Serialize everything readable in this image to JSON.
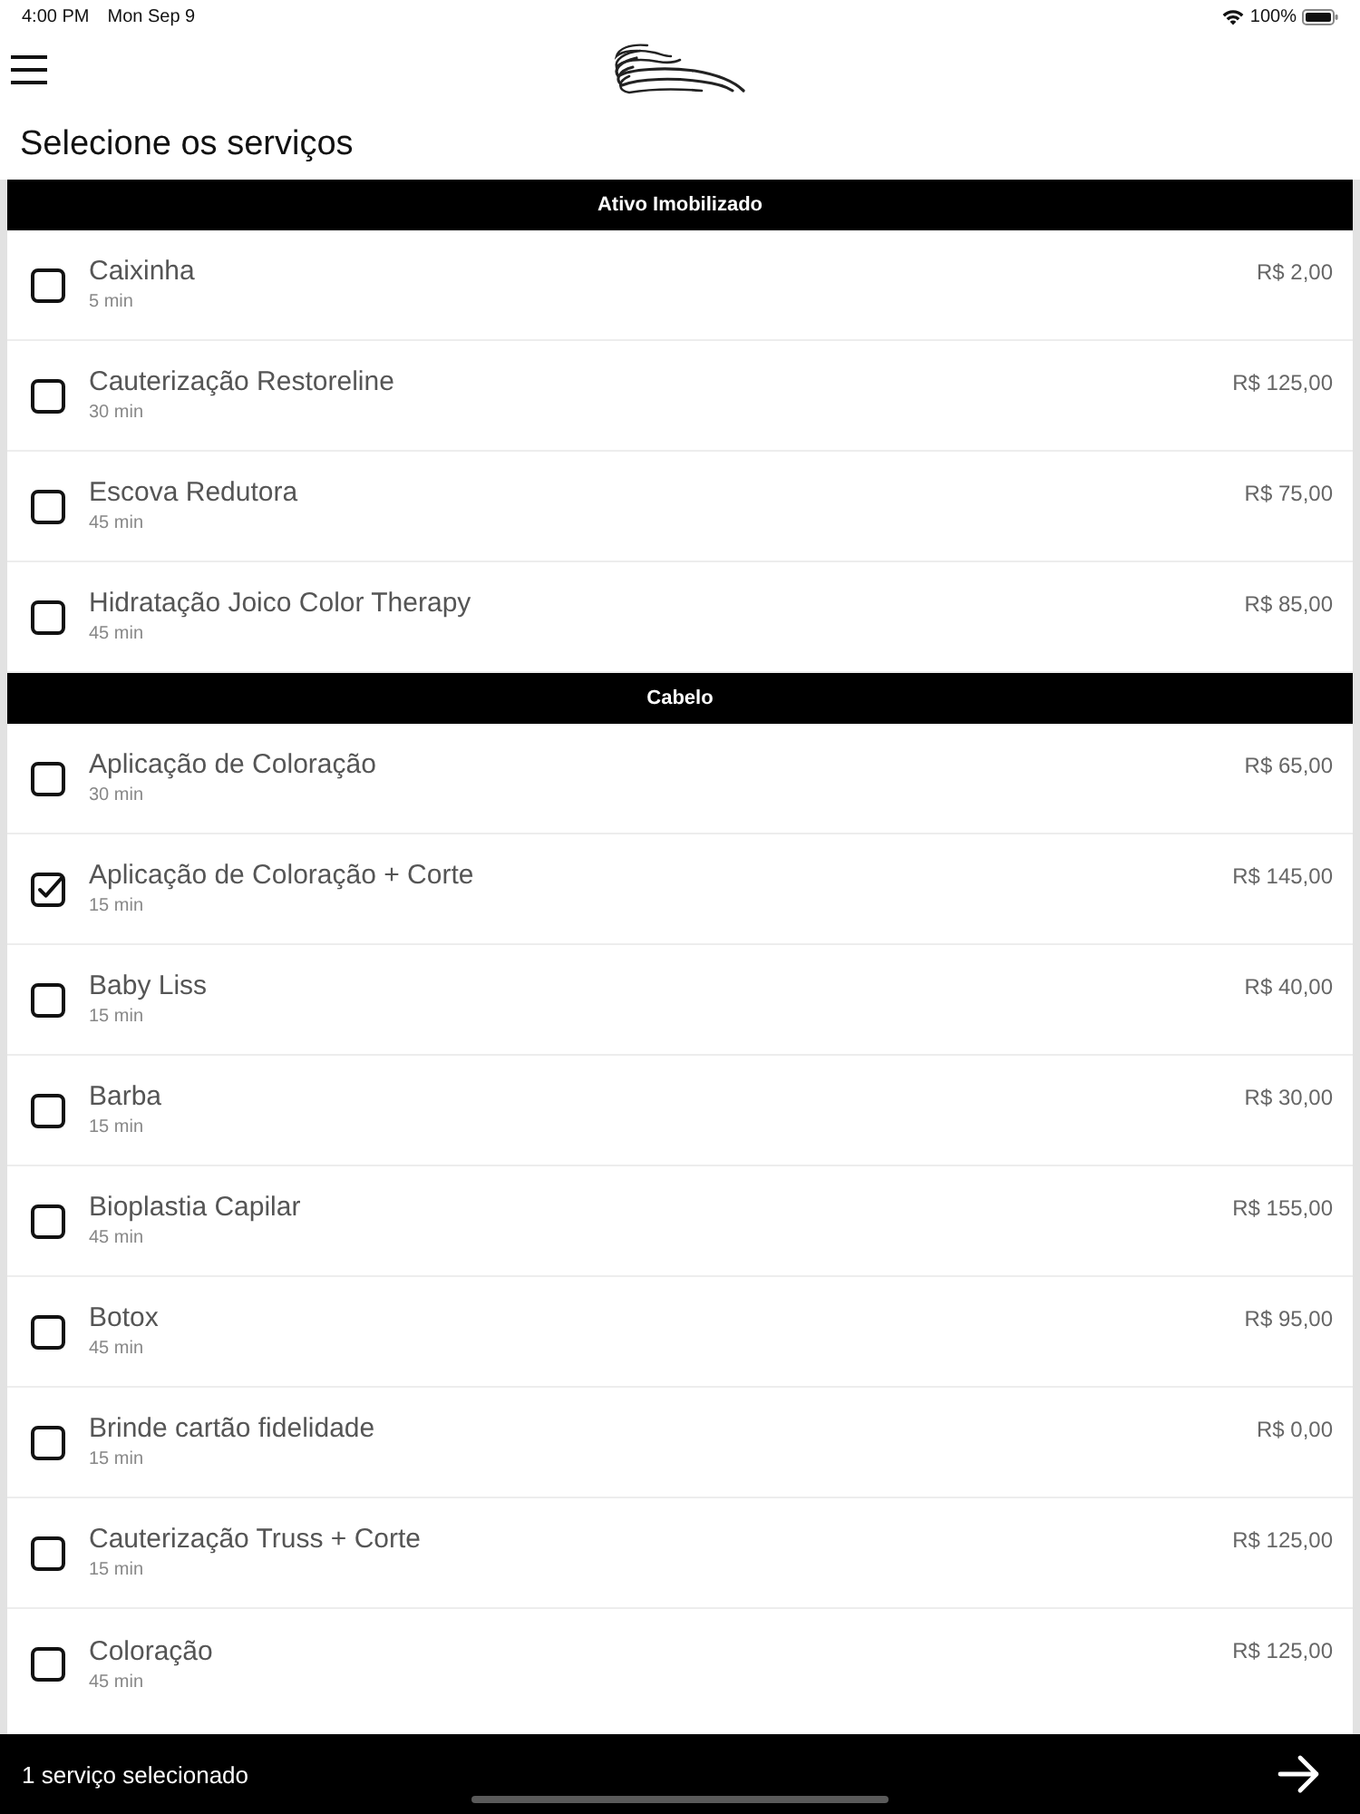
{
  "status_bar": {
    "time": "4:00 PM",
    "date": "Mon Sep 9",
    "battery": "100%"
  },
  "page_title": "Selecione os serviços",
  "sections": [
    {
      "title": "Ativo Imobilizado",
      "services": [
        {
          "name": "Caixinha",
          "duration": "5 min",
          "price": "R$ 2,00",
          "checked": false
        },
        {
          "name": "Cauterização Restoreline",
          "duration": "30 min",
          "price": "R$ 125,00",
          "checked": false
        },
        {
          "name": "Escova Redutora",
          "duration": "45 min",
          "price": "R$ 75,00",
          "checked": false
        },
        {
          "name": "Hidratação Joico Color Therapy",
          "duration": "45 min",
          "price": "R$ 85,00",
          "checked": false
        }
      ]
    },
    {
      "title": "Cabelo",
      "services": [
        {
          "name": "Aplicação de Coloração",
          "duration": "30 min",
          "price": "R$ 65,00",
          "checked": false
        },
        {
          "name": "Aplicação de Coloração + Corte",
          "duration": "15 min",
          "price": "R$ 145,00",
          "checked": true
        },
        {
          "name": "Baby Liss",
          "duration": "15 min",
          "price": "R$ 40,00",
          "checked": false
        },
        {
          "name": "Barba",
          "duration": "15 min",
          "price": "R$ 30,00",
          "checked": false
        },
        {
          "name": "Bioplastia Capilar",
          "duration": "45 min",
          "price": "R$ 155,00",
          "checked": false
        },
        {
          "name": "Botox",
          "duration": "45 min",
          "price": "R$ 95,00",
          "checked": false
        },
        {
          "name": "Brinde cartão fidelidade",
          "duration": "15 min",
          "price": "R$ 0,00",
          "checked": false
        },
        {
          "name": "Cauterização Truss + Corte",
          "duration": "15 min",
          "price": "R$ 125,00",
          "checked": false
        },
        {
          "name": "Coloração",
          "duration": "45 min",
          "price": "R$ 125,00",
          "checked": false
        }
      ]
    }
  ],
  "footer": {
    "summary": "1 serviço selecionado"
  }
}
